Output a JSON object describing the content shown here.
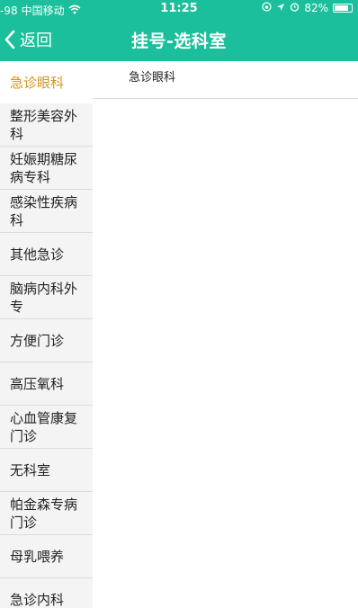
{
  "status_bar": {
    "signal": "-98",
    "carrier": "中国移动",
    "time": "11:25",
    "battery_pct": "82%",
    "battery_level": 0.82
  },
  "nav": {
    "back_label": "返回",
    "title": "挂号-选科室"
  },
  "sidebar": {
    "items": [
      {
        "label": "急诊眼科",
        "active": true
      },
      {
        "label": "整形美容外科",
        "active": false
      },
      {
        "label": "妊娠期糖尿病专科",
        "active": false
      },
      {
        "label": "感染性疾病科",
        "active": false
      },
      {
        "label": "其他急诊",
        "active": false
      },
      {
        "label": "脑病内科外专",
        "active": false
      },
      {
        "label": "方便门诊",
        "active": false
      },
      {
        "label": "高压氧科",
        "active": false
      },
      {
        "label": "心血管康复门诊",
        "active": false
      },
      {
        "label": "无科室",
        "active": false
      },
      {
        "label": "帕金森专病门诊",
        "active": false
      },
      {
        "label": "母乳喂养",
        "active": false
      },
      {
        "label": "急诊内科",
        "active": false
      }
    ]
  },
  "content": {
    "items": [
      {
        "label": "急诊眼科"
      }
    ]
  },
  "colors": {
    "header_bg": "#1cbf9c",
    "active_text": "#d4961e",
    "sidebar_bg": "#f4f4f4"
  }
}
